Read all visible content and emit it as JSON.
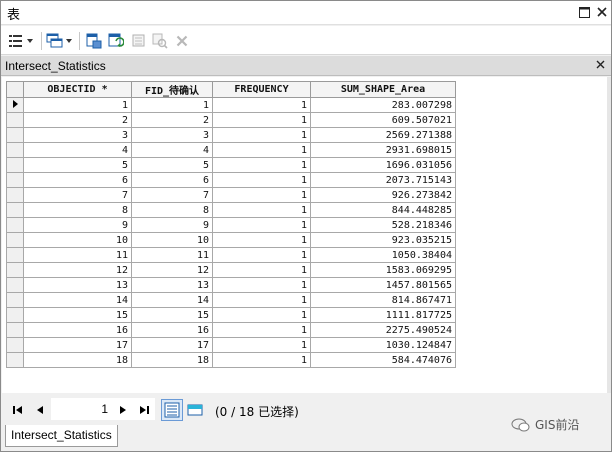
{
  "window": {
    "title": "表"
  },
  "layer_tab": {
    "title": "Intersect_Statistics"
  },
  "columns": [
    "OBJECTID *",
    "FID_待确认",
    "FREQUENCY",
    "SUM_SHAPE_Area"
  ],
  "rows": [
    [
      "1",
      "1",
      "1",
      "283.007298"
    ],
    [
      "2",
      "2",
      "1",
      "609.507021"
    ],
    [
      "3",
      "3",
      "1",
      "2569.271388"
    ],
    [
      "4",
      "4",
      "1",
      "2931.698015"
    ],
    [
      "5",
      "5",
      "1",
      "1696.031056"
    ],
    [
      "6",
      "6",
      "1",
      "2073.715143"
    ],
    [
      "7",
      "7",
      "1",
      "926.273842"
    ],
    [
      "8",
      "8",
      "1",
      "844.448285"
    ],
    [
      "9",
      "9",
      "1",
      "528.218346"
    ],
    [
      "10",
      "10",
      "1",
      "923.035215"
    ],
    [
      "11",
      "11",
      "1",
      "1050.38404"
    ],
    [
      "12",
      "12",
      "1",
      "1583.069295"
    ],
    [
      "13",
      "13",
      "1",
      "1457.801565"
    ],
    [
      "14",
      "14",
      "1",
      "814.867471"
    ],
    [
      "15",
      "15",
      "1",
      "1111.817725"
    ],
    [
      "16",
      "16",
      "1",
      "2275.490524"
    ],
    [
      "17",
      "17",
      "1",
      "1030.124847"
    ],
    [
      "18",
      "18",
      "1",
      "584.474076"
    ]
  ],
  "navigation": {
    "current_record": "1",
    "selection_info": "(0 / 18 已选择)"
  },
  "bottom_tab": {
    "label": "Intersect_Statistics"
  },
  "watermark": {
    "text": "GIS前沿"
  },
  "icons": {
    "table_options": "table-options-icon",
    "related_tables": "related-tables-icon",
    "select_by_attributes": "select-by-attributes-icon",
    "switch_selection": "switch-selection-icon",
    "clear_selection": "clear-selection-icon",
    "zoom_to_selected": "zoom-to-selected-icon",
    "delete_selected": "delete-selected-icon"
  }
}
